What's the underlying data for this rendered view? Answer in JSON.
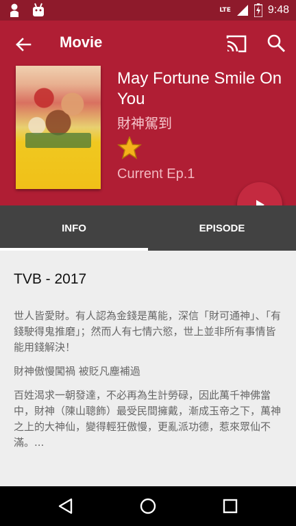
{
  "status_bar": {
    "time": "9:48",
    "network": "LTE",
    "icons": [
      "person-icon",
      "android-icon",
      "lte-signal-icon",
      "battery-icon"
    ]
  },
  "toolbar": {
    "title": "Movie",
    "icons": [
      "back-arrow-icon",
      "cast-icon",
      "search-icon"
    ]
  },
  "movie": {
    "title_en": "May Fortune Smile On You",
    "title_zh": "財神駕到",
    "favorite_icon": "star-icon",
    "current_episode": "Current Ep.1"
  },
  "tabs": [
    {
      "label": "INFO",
      "selected": true
    },
    {
      "label": "EPISODE",
      "selected": false
    }
  ],
  "content": {
    "heading": "TVB - 2017",
    "paragraphs": [
      "世人皆愛財。有人認為金錢是萬能，深信「財可通神」、「有錢駛得鬼推磨」；然而人有七情六慾，世上並非所有事情皆能用錢解決！",
      "財神傲慢闖禍 被貶凡塵補過",
      "百姓渴求一朝發達，不必再為生計勞碌，因此萬千神佛當中，財神（陳山聰飾）最受民間擁戴，漸成玉帝之下，萬神之上的大神仙，變得輕狂傲慢，更亂派功德，惹來眾仙不滿。..."
    ]
  },
  "colors": {
    "status_bar": "#8e1a2b",
    "app_bar": "#b01e34",
    "fab": "#c42a40",
    "tab_bar": "#424242",
    "background": "#eeeeee"
  },
  "nav_bar": {
    "icons": [
      "back-triangle-icon",
      "home-circle-icon",
      "recents-square-icon"
    ]
  }
}
